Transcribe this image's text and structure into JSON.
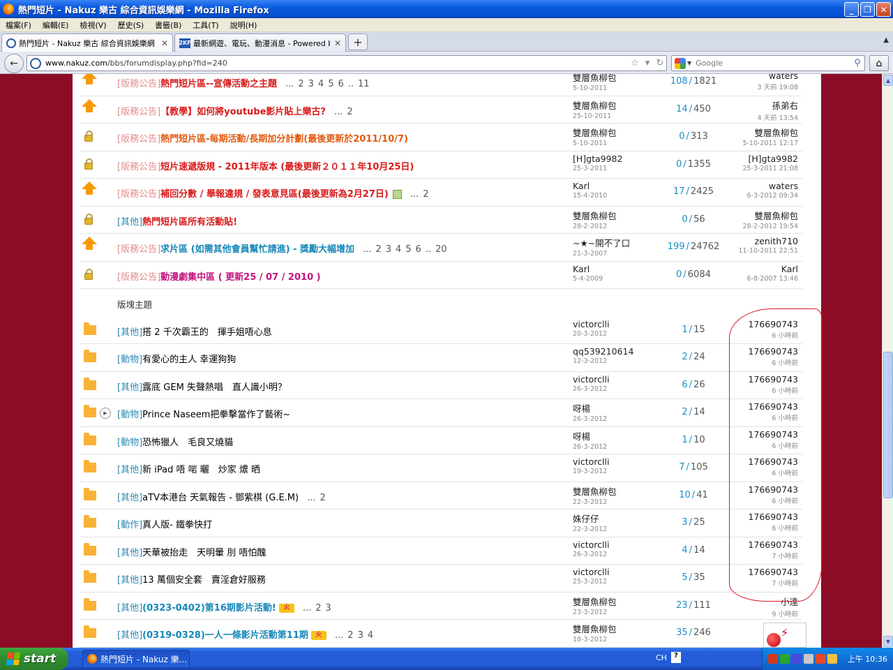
{
  "window": {
    "title": "熱門短片 - Nakuz 樂古 綜合資訊娛樂網 - Mozilla Firefox",
    "minimize": "_",
    "maximize": "❐",
    "close": "✕"
  },
  "menu": [
    "檔案(F)",
    "編輯(E)",
    "檢視(V)",
    "歷史(S)",
    "書籤(B)",
    "工具(T)",
    "說明(H)"
  ],
  "tabs": [
    {
      "label": "熱門短片 - Nakuz 樂古 綜合資訊娛樂網",
      "active": true
    },
    {
      "label": "最新網遊、電玩、動漫消息 - Powered b...",
      "icon_text": "2KF",
      "active": false
    }
  ],
  "nav": {
    "url_host": "www.nakuz.com",
    "url_path": "/bbs/forumdisplay.php?fid=240",
    "search_placeholder": "Google"
  },
  "pinned_threads": [
    {
      "icon": "up",
      "category": "[版務公告]",
      "title": "熱門短片區--宣傳活動之主題",
      "title_style": "red",
      "pages": [
        "...",
        "2",
        "3",
        "4",
        "5",
        "6",
        "..",
        "11"
      ],
      "author": "雙層魚柳包",
      "author_date": "5-10-2011",
      "replies": "108",
      "views": "1821",
      "last_user": "waters",
      "last_time": "3 天前 19:08"
    },
    {
      "icon": "up",
      "category": "[版務公告]",
      "title": "【教學】如何將youtube影片貼上樂古?",
      "title_style": "red",
      "pages": [
        "...",
        "2"
      ],
      "author": "雙層魚柳包",
      "author_date": "25-10-2011",
      "replies": "14",
      "views": "450",
      "last_user": "孫弟右",
      "last_time": "4 天前 13:54"
    },
    {
      "icon": "lock",
      "category": "[版務公告]",
      "title": "熱門短片區-每期活動/長期加分計劃(最後更新於2011/10/7)",
      "title_style": "orange",
      "pages": [],
      "author": "雙層魚柳包",
      "author_date": "5-10-2011",
      "replies": "0",
      "views": "313",
      "last_user": "雙層魚柳包",
      "last_time": "5-10-2011 12:17"
    },
    {
      "icon": "lock",
      "category": "[版務公告]",
      "title": "短片速遞版規 - 2011年版本 (最後更新２０１１年10月25日)",
      "title_style": "red",
      "pages": [],
      "author": "[H]gta9982",
      "author_date": "25-3-2011",
      "replies": "0",
      "views": "1355",
      "last_user": "[H]gta9982",
      "last_time": "25-3-2011 21:08"
    },
    {
      "icon": "up",
      "category": "[版務公告]",
      "title": "補回分數 / 舉報違規 / 發表意見區(最後更新為2月27日)",
      "title_style": "red",
      "has_pic": true,
      "pages": [
        "...",
        "2"
      ],
      "author": "Karl",
      "author_date": "15-4-2010",
      "replies": "17",
      "views": "2425",
      "last_user": "waters",
      "last_time": "6-3-2012 09:34"
    },
    {
      "icon": "lock",
      "category": "[其他]",
      "title": "熱門短片區所有活動貼!",
      "title_style": "red",
      "pages": [],
      "author": "雙層魚柳包",
      "author_date": "28-2-2012",
      "replies": "0",
      "views": "56",
      "last_user": "雙層魚柳包",
      "last_time": "28-2-2012 19:54"
    },
    {
      "icon": "up",
      "category": "[版務公告]",
      "title": "求片區 (如需其他會員幫忙請進) - 獎勵大幅增加",
      "title_style": "blue",
      "pages": [
        "...",
        "2",
        "3",
        "4",
        "5",
        "6",
        "..",
        "20"
      ],
      "author": "~★~開不了口",
      "author_date": "21-3-2007",
      "replies": "199",
      "views": "24762",
      "last_user": "zenith710",
      "last_time": "11-10-2011 22:51"
    },
    {
      "icon": "lock",
      "category": "[版務公告]",
      "title": "動漫劇集中區 ( 更新25 / 07 / 2010 )",
      "title_style": "magenta",
      "pages": [],
      "author": "Karl",
      "author_date": "5-4-2009",
      "replies": "0",
      "views": "6084",
      "last_user": "Karl",
      "last_time": "6-8-2007 13:46"
    }
  ],
  "section_label": "版塊主題",
  "threads": [
    {
      "category": "[其他]",
      "title": "搭 2 千次霸王的　揮手姐唔心息",
      "title_style": "normal",
      "author": "victorclli",
      "author_date": "20-3-2012",
      "replies": "1",
      "views": "15",
      "last_user": "176690743",
      "last_time": "6 小時前"
    },
    {
      "category": "[動物]",
      "title": "有愛心的主人 幸運狗狗",
      "title_style": "normal",
      "author": "qq539210614",
      "author_date": "12-3-2012",
      "replies": "2",
      "views": "24",
      "last_user": "176690743",
      "last_time": "6 小時前"
    },
    {
      "category": "[其他]",
      "title": "露底 GEM 失聲熱唱　直人識小明？",
      "title_style": "normal",
      "author": "victorclli",
      "author_date": "26-3-2012",
      "replies": "6",
      "views": "26",
      "last_user": "176690743",
      "last_time": "6 小時前"
    },
    {
      "category": "[動物]",
      "title": "Prince Naseem把拳擊當作了藝術~",
      "title_style": "normal",
      "has_play": true,
      "author": "呀楊",
      "author_date": "26-3-2012",
      "replies": "2",
      "views": "14",
      "last_user": "176690743",
      "last_time": "6 小時前"
    },
    {
      "category": "[動物]",
      "title": "恐怖獵人　毛良又燒貓",
      "title_style": "normal",
      "author": "呀楊",
      "author_date": "26-3-2012",
      "replies": "1",
      "views": "10",
      "last_user": "176690743",
      "last_time": "6 小時前"
    },
    {
      "category": "[其他]",
      "title": "新 iPad 唔 啱 曬　炒家 燶 晒",
      "title_style": "normal",
      "author": "victorclli",
      "author_date": "19-3-2012",
      "replies": "7",
      "views": "105",
      "last_user": "176690743",
      "last_time": "6 小時前"
    },
    {
      "category": "[其他]",
      "title": "aTV本港台 天氣報告 - 鄧紫棋 (G.E.M)",
      "title_style": "normal",
      "pages": [
        "...",
        "2"
      ],
      "author": "雙層魚柳包",
      "author_date": "22-3-2012",
      "replies": "10",
      "views": "41",
      "last_user": "176690743",
      "last_time": "6 小時前"
    },
    {
      "category": "[動作]",
      "title": "真人版- 鐵拳快打",
      "title_style": "normal",
      "author": "姝仔仔",
      "author_date": "22-3-2012",
      "replies": "3",
      "views": "25",
      "last_user": "176690743",
      "last_time": "6 小時前"
    },
    {
      "category": "[其他]",
      "title": "天華被抬走　天明暈 刖 唔怕醜",
      "title_style": "normal",
      "author": "victorclli",
      "author_date": "26-3-2012",
      "replies": "4",
      "views": "14",
      "last_user": "176690743",
      "last_time": "7 小時前"
    },
    {
      "category": "[其他]",
      "title": "13 萬個安全套　賣淫倉好服務",
      "title_style": "normal",
      "author": "victorclli",
      "author_date": "25-3-2012",
      "replies": "5",
      "views": "35",
      "last_user": "176690743",
      "last_time": "7 小時前"
    },
    {
      "category": "[其他]",
      "title": "(0323-0402)第16期影片活動!",
      "title_style": "blue",
      "has_hot": true,
      "pages": [
        "...",
        "2",
        "3"
      ],
      "author": "雙層魚柳包",
      "author_date": "23-3-2012",
      "replies": "23",
      "views": "111",
      "last_user": "小達",
      "last_time": "9 小時前"
    },
    {
      "category": "[其他]",
      "title": "(0319-0328)一人一條影片活動第11期",
      "title_style": "blue",
      "has_hot": true,
      "pages": [
        "...",
        "2",
        "3",
        "4"
      ],
      "author": "雙層魚柳包",
      "author_date": "18-3-2012",
      "replies": "35",
      "views": "246",
      "last_user": "",
      "last_time": ""
    }
  ],
  "taskbar": {
    "start_label": "start",
    "task_label": "熱門短片 - Nakuz 樂...",
    "lang": "CH",
    "clock": "上午 10:36"
  }
}
